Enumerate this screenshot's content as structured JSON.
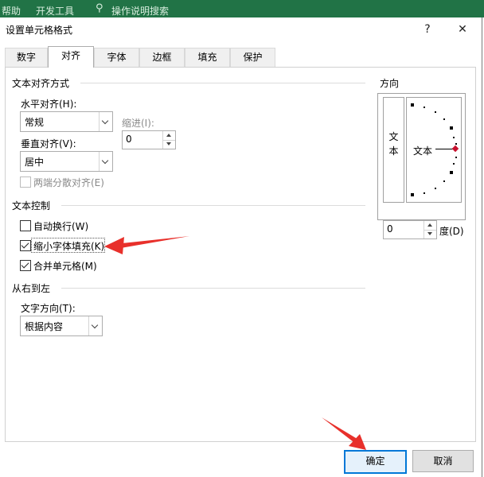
{
  "ribbon": {
    "items": [
      "帮助",
      "开发工具",
      "操作说明搜索"
    ]
  },
  "dialog": {
    "title": "设置单元格格式",
    "help_label": "?",
    "close_label": "✕",
    "tabs": [
      {
        "label": "数字",
        "active": false
      },
      {
        "label": "对齐",
        "active": true
      },
      {
        "label": "字体",
        "active": false
      },
      {
        "label": "边框",
        "active": false
      },
      {
        "label": "填充",
        "active": false
      },
      {
        "label": "保护",
        "active": false
      }
    ],
    "text_alignment": {
      "section_label": "文本对齐方式",
      "horizontal_label": "水平对齐(H):",
      "horizontal_value": "常规",
      "indent_label": "缩进(I):",
      "indent_value": "0",
      "vertical_label": "垂直对齐(V):",
      "vertical_value": "居中",
      "distributed_label": "两端分散对齐(E)",
      "distributed_checked": false
    },
    "text_control": {
      "section_label": "文本控制",
      "wrap_label": "自动换行(W)",
      "wrap_checked": false,
      "shrink_label": "缩小字体填充(K)",
      "shrink_checked": true,
      "merge_label": "合并单元格(M)",
      "merge_checked": true
    },
    "rtl": {
      "section_label": "从右到左",
      "direction_label": "文字方向(T):",
      "direction_value": "根据内容"
    },
    "orientation": {
      "section_label": "方向",
      "vertical_text_chars": [
        "文",
        "本"
      ],
      "dial_text": "文本",
      "degree_value": "0",
      "degree_label": "度(D)"
    },
    "buttons": {
      "ok": "确定",
      "cancel": "取消"
    }
  },
  "colors": {
    "ribbon": "#217346",
    "arrow": "#e8302b",
    "accent": "#0078d7"
  }
}
